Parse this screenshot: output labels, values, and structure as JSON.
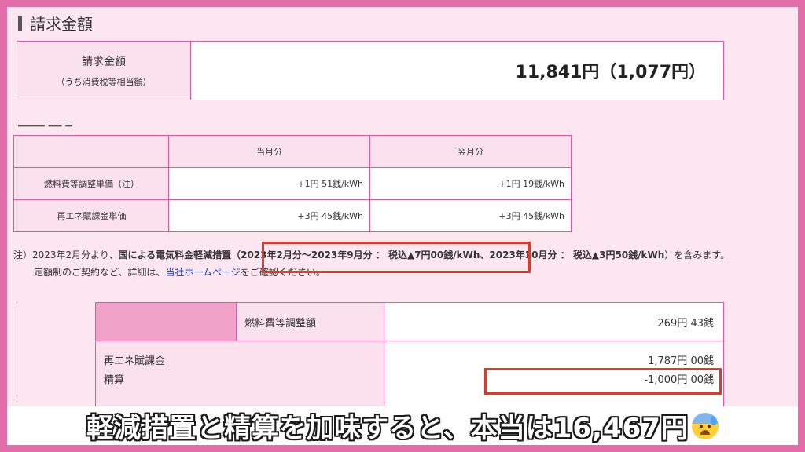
{
  "section": {
    "title": "請求金額"
  },
  "billing": {
    "label": "請求金額",
    "sublabel": "（うち消費税等相当額）",
    "amount": "11,841円（1,077円）"
  },
  "unit_table": {
    "headers": [
      "",
      "当月分",
      "翌月分"
    ],
    "rows": [
      {
        "label": "燃料費等調整単価（注）",
        "current": "+1円 51銭/kWh",
        "next": "+1円 19銭/kWh"
      },
      {
        "label": "再エネ賦課金単価",
        "current": "+3円 45銭/kWh",
        "next": "+3円 45銭/kWh"
      }
    ]
  },
  "note": {
    "prefix": "注）2023年2月分より、",
    "bold1": "国による電気料金軽減措置",
    "highlight": "（2023年2月分〜2023年9月分 ： 税込▲7円00銭/kWh、",
    "bold2": "2023年10月分 ： 税込▲3円50銭/kWh",
    "suffix": "）を含みます。",
    "line2_prefix": "定額制のご契約など、詳細は、",
    "link": "当社ホームページ",
    "line2_suffix": "をご確認ください。"
  },
  "detail": {
    "fuel_label": "燃料費等調整額",
    "fuel_amount": "269円 43銭",
    "renew_label": "再エネ賦課金",
    "renew_amount": "1,787円 00銭",
    "settle_label": "精算",
    "settle_amount": "-1,000円 00銭"
  },
  "caption": {
    "text": "軽減措置と精算を加味すると、本当は16,467円",
    "emoji": "anxious-face-with-sweat"
  },
  "colors": {
    "frame": "#e46ea9",
    "border": "#e8559c",
    "highlight": "#d93b2c"
  }
}
